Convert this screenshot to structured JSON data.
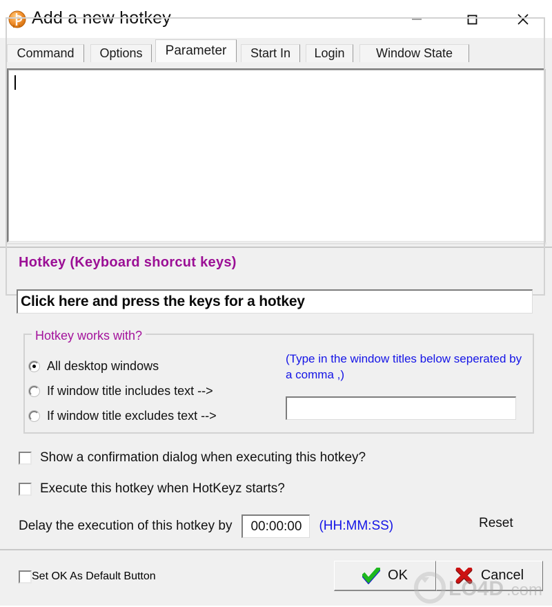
{
  "window": {
    "title": "Add a new hotkey",
    "icon": "hotkeyz-orange-icon",
    "minimize_label": "Minimize",
    "maximize_label": "Maximize",
    "close_label": "Close"
  },
  "tabs": [
    {
      "label": "Command",
      "active": false
    },
    {
      "label": "Options",
      "active": false
    },
    {
      "label": "Parameter",
      "active": true
    },
    {
      "label": "Start In",
      "active": false
    },
    {
      "label": "Login",
      "active": false
    },
    {
      "label": "Window State",
      "active": false
    }
  ],
  "parameter": {
    "value": "",
    "placeholder": ""
  },
  "hotkey_group": {
    "legend": "Hotkey (Keyboard shorcut keys)",
    "legend_color": "#9b0f95",
    "input_value": "Click here and press the keys for a hotkey",
    "works_with": {
      "legend": "Hotkey works with?",
      "options": [
        {
          "label": "All desktop windows",
          "selected": true
        },
        {
          "label": "If window title includes text -->",
          "selected": false
        },
        {
          "label": "If window title excludes text -->",
          "selected": false
        }
      ],
      "hint": "(Type in the window titles below seperated by a comma ,)",
      "hint_color": "#1414e6",
      "titles_value": "",
      "titles_placeholder": ""
    },
    "checkboxes": [
      {
        "label": "Show a confirmation dialog when executing this hotkey?",
        "checked": false
      },
      {
        "label": "Execute this hotkey when HotKeyz starts?",
        "checked": false
      }
    ],
    "delay": {
      "label": "Delay the execution of this hotkey by",
      "value": "00:00:00",
      "format": "(HH:MM:SS)",
      "format_color": "#1414e6",
      "reset_label": "Reset"
    }
  },
  "footer": {
    "default_button_checkbox": {
      "label": "Set OK As Default Button",
      "checked": false
    },
    "ok_label": "OK",
    "cancel_label": "Cancel",
    "ok_icon": "green-check-icon",
    "cancel_icon": "red-x-icon"
  },
  "watermark": {
    "text": "LO4D.com"
  }
}
